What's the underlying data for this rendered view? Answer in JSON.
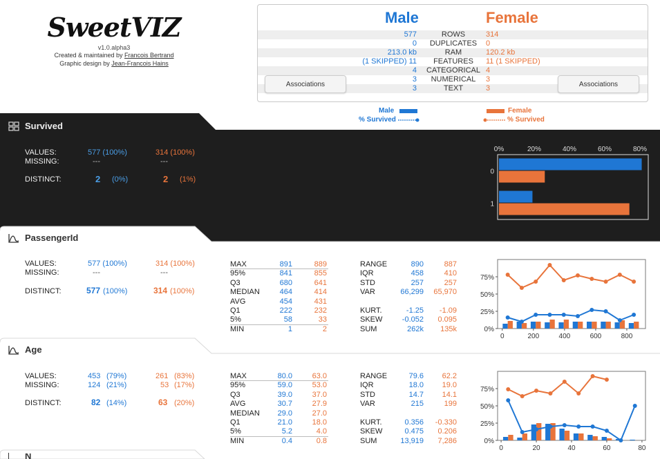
{
  "logo": {
    "brand": "SweetVIZ",
    "version": "v1.0.alpha3",
    "credit_prefix": "Created & maintained by ",
    "credit_name": "Francois Bertrand",
    "design_prefix": "Graphic design by ",
    "design_name": "Jean-Francois Hains"
  },
  "summary": {
    "left_title": "Male",
    "right_title": "Female",
    "rows": [
      {
        "label": "ROWS",
        "left": "577",
        "right": "314"
      },
      {
        "label": "DUPLICATES",
        "left": "0",
        "right": "0"
      },
      {
        "label": "RAM",
        "left": "213.0 kb",
        "right": "120.2 kb"
      },
      {
        "label": "FEATURES",
        "left": "(1 SKIPPED) 11",
        "right": "11 (1 SKIPPED)"
      },
      {
        "label": "CATEGORICAL",
        "left": "4",
        "right": "4"
      },
      {
        "label": "NUMERICAL",
        "left": "3",
        "right": "3"
      },
      {
        "label": "TEXT",
        "left": "3",
        "right": "3"
      }
    ],
    "assoc_left": "Associations",
    "assoc_right": "Associations"
  },
  "legend": {
    "male": "Male",
    "male_pct": "% Survived",
    "female": "Female",
    "female_pct": "% Survived"
  },
  "colors": {
    "male": "#1f77d4",
    "female": "#e8743b",
    "dark": "#1e1e1e"
  },
  "survived": {
    "title": "Survived",
    "values_label": "VALUES:",
    "missing_label": "MISSING:",
    "distinct_label": "DISTINCT:",
    "m_values": "577 (100%)",
    "f_values": "314 (100%)",
    "m_missing": "---",
    "f_missing": "---",
    "m_distinct": "2",
    "m_distinct_pct": "(0%)",
    "f_distinct": "2",
    "f_distinct_pct": "(1%)"
  },
  "passenger": {
    "title": "PassengerId",
    "values_label": "VALUES:",
    "missing_label": "MISSING:",
    "distinct_label": "DISTINCT:",
    "m_values": "577 (100%)",
    "f_values": "314 (100%)",
    "m_missing": "---",
    "f_missing": "---",
    "m_distinct": "577",
    "m_distinct_pct": "(100%)",
    "f_distinct": "314",
    "f_distinct_pct": "(100%)",
    "stats1": [
      {
        "k": "MAX",
        "m": "891",
        "f": "889"
      },
      {
        "k": "95%",
        "m": "841",
        "f": "855"
      },
      {
        "k": "Q3",
        "m": "680",
        "f": "641"
      },
      {
        "k": "MEDIAN",
        "m": "464",
        "f": "414"
      },
      {
        "k": "AVG",
        "m": "454",
        "f": "431"
      },
      {
        "k": "Q1",
        "m": "222",
        "f": "232"
      },
      {
        "k": "5%",
        "m": "58",
        "f": "33"
      },
      {
        "k": "MIN",
        "m": "1",
        "f": "2"
      }
    ],
    "stats2": [
      {
        "k": "RANGE",
        "m": "890",
        "f": "887"
      },
      {
        "k": "IQR",
        "m": "458",
        "f": "410"
      },
      {
        "k": "STD",
        "m": "257",
        "f": "257"
      },
      {
        "k": "VAR",
        "m": "66,299",
        "f": "65,970"
      }
    ],
    "stats3": [
      {
        "k": "KURT.",
        "m": "-1.25",
        "f": "-1.09"
      },
      {
        "k": "SKEW",
        "m": "-0.052",
        "f": "0.095"
      },
      {
        "k": "SUM",
        "m": "262k",
        "f": "135k"
      }
    ]
  },
  "age": {
    "title": "Age",
    "values_label": "VALUES:",
    "missing_label": "MISSING:",
    "distinct_label": "DISTINCT:",
    "m_values": "453",
    "m_values_pct": "(79%)",
    "f_values": "261",
    "f_values_pct": "(83%)",
    "m_missing": "124",
    "m_missing_pct": "(21%)",
    "f_missing": "53",
    "f_missing_pct": "(17%)",
    "m_distinct": "82",
    "m_distinct_pct": "(14%)",
    "f_distinct": "63",
    "f_distinct_pct": "(20%)",
    "stats1": [
      {
        "k": "MAX",
        "m": "80.0",
        "f": "63.0"
      },
      {
        "k": "95%",
        "m": "59.0",
        "f": "53.0"
      },
      {
        "k": "Q3",
        "m": "39.0",
        "f": "37.0"
      },
      {
        "k": "AVG",
        "m": "30.7",
        "f": "27.9"
      },
      {
        "k": "MEDIAN",
        "m": "29.0",
        "f": "27.0"
      },
      {
        "k": "Q1",
        "m": "21.0",
        "f": "18.0"
      },
      {
        "k": "5%",
        "m": "5.2",
        "f": "4.0"
      },
      {
        "k": "MIN",
        "m": "0.4",
        "f": "0.8"
      }
    ],
    "stats2": [
      {
        "k": "RANGE",
        "m": "79.6",
        "f": "62.2"
      },
      {
        "k": "IQR",
        "m": "18.0",
        "f": "19.0"
      },
      {
        "k": "STD",
        "m": "14.7",
        "f": "14.1"
      },
      {
        "k": "VAR",
        "m": "215",
        "f": "199"
      }
    ],
    "stats3": [
      {
        "k": "KURT.",
        "m": "0.356",
        "f": "-0.330"
      },
      {
        "k": "SKEW",
        "m": "0.475",
        "f": "0.206"
      },
      {
        "k": "SUM",
        "m": "13,919",
        "f": "7,286"
      }
    ]
  },
  "next_section_initial": "N",
  "chart_data": [
    {
      "type": "bar",
      "orientation": "horizontal",
      "categories": [
        "0",
        "1"
      ],
      "series": [
        {
          "name": "Male",
          "values": [
            81,
            19
          ]
        },
        {
          "name": "Female",
          "values": [
            26,
            74
          ]
        }
      ],
      "xlim": [
        0,
        80
      ],
      "xticks": [
        "0%",
        "20%",
        "40%",
        "60%",
        "80%"
      ]
    },
    {
      "type": "bar",
      "x": [
        35,
        125,
        215,
        305,
        395,
        485,
        575,
        665,
        755,
        845
      ],
      "series": [
        {
          "name": "Male",
          "values": [
            7,
            10,
            10,
            9,
            9,
            10,
            10,
            10,
            9,
            8
          ]
        },
        {
          "name": "Female",
          "values": [
            11,
            8,
            10,
            13,
            13,
            10,
            10,
            10,
            12,
            10
          ]
        },
        {
          "name": "% Survived",
          "kind": "line",
          "axis": "male",
          "values": [
            16,
            10,
            20,
            20,
            20,
            18,
            27,
            25,
            12,
            20
          ]
        },
        {
          "name": "% Survived",
          "kind": "line",
          "axis": "female",
          "values": [
            78,
            59,
            68,
            92,
            70,
            77,
            72,
            68,
            78,
            68
          ]
        }
      ],
      "xlim": [
        -30,
        920
      ],
      "ylim": [
        0,
        100
      ],
      "xticks": [
        0,
        200,
        400,
        600,
        800
      ],
      "yticks": [
        "0%",
        "25%",
        "50%",
        "75%"
      ]
    },
    {
      "type": "bar",
      "x": [
        4,
        12,
        20,
        28,
        36,
        44,
        52,
        60,
        68,
        76
      ],
      "series": [
        {
          "name": "Male",
          "values": [
            5,
            4,
            23,
            24,
            17,
            10,
            8,
            5,
            2,
            1
          ]
        },
        {
          "name": "Female",
          "values": [
            8,
            10,
            25,
            25,
            14,
            10,
            6,
            3,
            0,
            0
          ]
        },
        {
          "name": "% Survived",
          "kind": "line",
          "axis": "male",
          "values": [
            58,
            12,
            16,
            20,
            22,
            20,
            20,
            14,
            0,
            50
          ]
        },
        {
          "name": "% Survived",
          "kind": "line",
          "axis": "female",
          "values": [
            74,
            64,
            72,
            68,
            85,
            68,
            93,
            88
          ]
        }
      ],
      "xlim": [
        -2,
        82
      ],
      "ylim": [
        0,
        100
      ],
      "xticks": [
        0,
        20,
        40,
        60,
        80
      ],
      "yticks": [
        "0%",
        "25%",
        "50%",
        "75%"
      ]
    }
  ]
}
